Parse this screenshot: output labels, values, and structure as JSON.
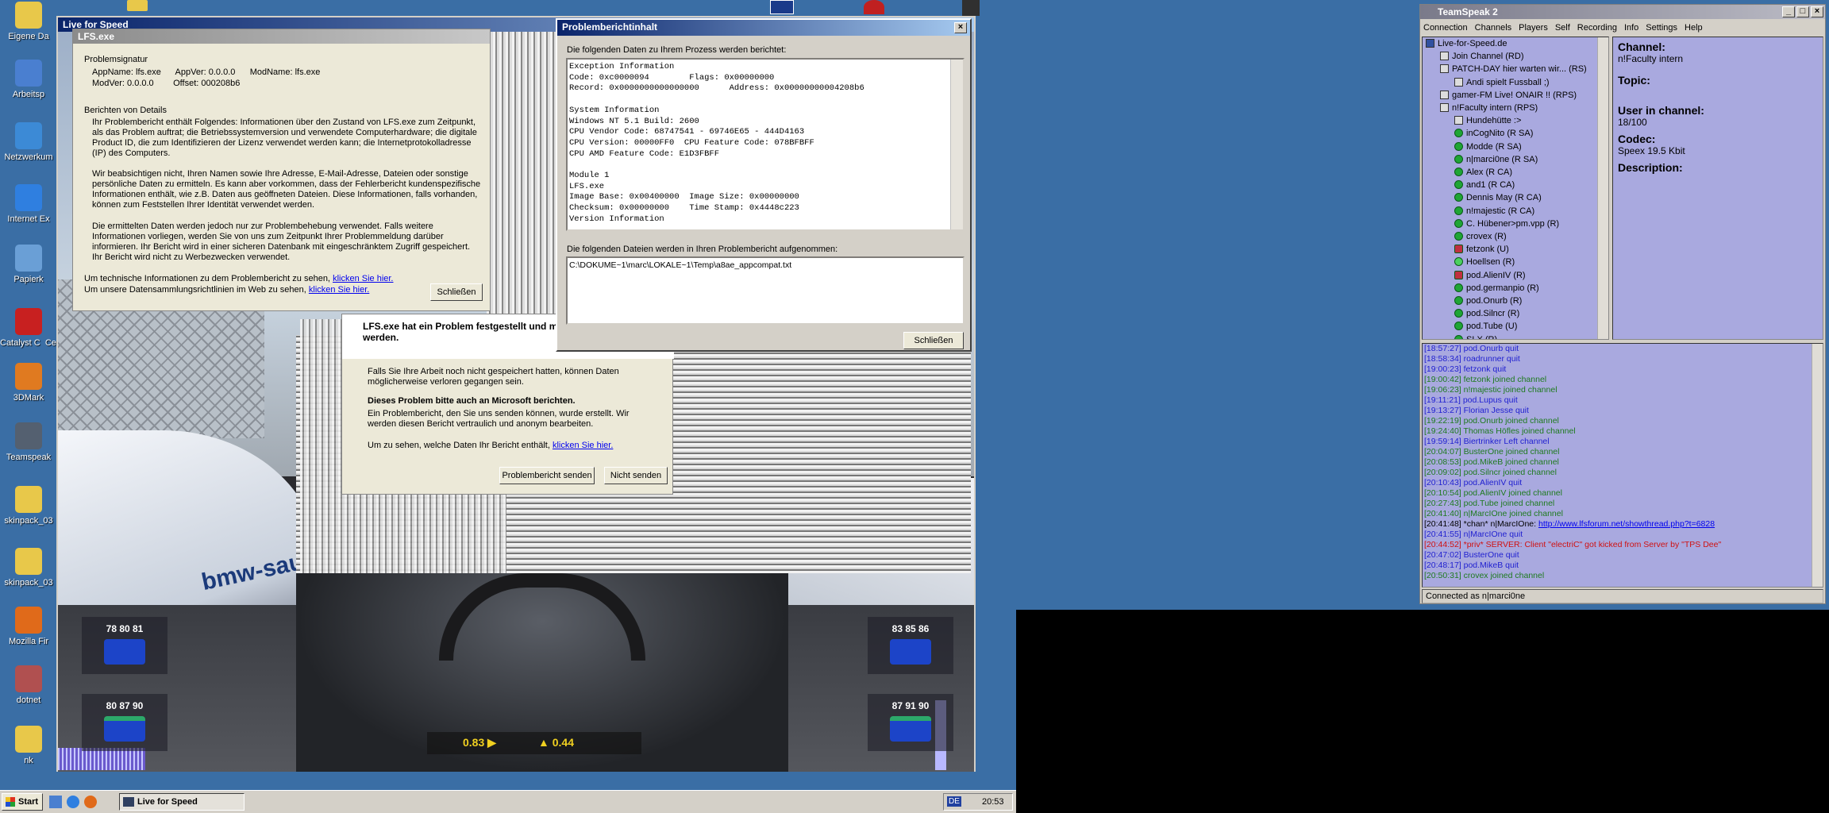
{
  "desktop": {
    "icons": [
      {
        "label": "Eigene Da",
        "color": "#e8c84a"
      },
      {
        "label": "Arbeitsp",
        "color": "#4a7fd0"
      },
      {
        "label": "Netzwerkum",
        "color": "#3c8ad6"
      },
      {
        "label": "Internet Ex",
        "color": "#2f7fe0"
      },
      {
        "label": "Papierk",
        "color": "#6a9fd6"
      },
      {
        "label": "Catalyst C  Cente",
        "color": "#c82020"
      },
      {
        "label": "3DMark",
        "color": "#e07a20"
      },
      {
        "label": "Teamspeak",
        "color": "#546070"
      },
      {
        "label": "skinpack_03",
        "color": "#e8c84a"
      },
      {
        "label": "skinpack_03",
        "color": "#e8c84a"
      },
      {
        "label": "Mozilla Fir",
        "color": "#e06a1a"
      },
      {
        "label": "dotnet",
        "color": "#b05050"
      },
      {
        "label": "nk",
        "color": "#e8c84a"
      }
    ]
  },
  "lfs_window": {
    "title": "Live for Speed",
    "hud": {
      "tyre_fl": "78 80 81",
      "tyre_fr": "83 85 86",
      "tyre_rl": "80 87 90",
      "tyre_rr": "87 91 90",
      "readout_left": "0.83 ▶",
      "readout_right": "▲ 0.44",
      "car_livery": "bmw-saub"
    }
  },
  "lfs_dialog": {
    "title": "LFS.exe",
    "signature_heading": "Problemsignatur",
    "signature_line1": "AppName: lfs.exe      AppVer: 0.0.0.0      ModName: lfs.exe",
    "signature_line2": "ModVer: 0.0.0.0        Offset: 000208b6",
    "details_heading": "Berichten von Details",
    "para1": "Ihr Problembericht enthält Folgendes: Informationen über den Zustand von LFS.exe zum Zeitpunkt, als das Problem auftrat; die Betriebssystemversion und verwendete Computerhardware; die digitale Product ID, die zum Identifizieren der Lizenz verwendet werden kann; die Internetprotokolladresse (IP) des Computers.",
    "para2": "Wir beabsichtigen nicht, Ihren Namen sowie Ihre Adresse, E-Mail-Adresse, Dateien oder sonstige persönliche Daten zu ermitteln. Es kann aber vorkommen, dass der Fehlerbericht kundenspezifische Informationen enthält, wie z.B. Daten aus geöffneten Dateien. Diese Informationen, falls vorhanden, können zum Feststellen Ihrer Identität verwendet werden.",
    "para3": "Die ermittelten Daten werden jedoch nur zur Problembehebung verwendet. Falls weitere Informationen vorliegen, werden Sie von uns zum Zeitpunkt Ihrer Problemmeldung darüber informieren. Ihr Bericht wird in einer sicheren Datenbank mit eingeschränktem Zugriff gespeichert. Ihr Bericht wird nicht zu Werbezwecken verwendet.",
    "tech_text": "Um technische Informationen zu dem Problembericht zu sehen,",
    "tech_link": "klicken Sie hier.",
    "policy_text": "Um unsere Datensammlungsrichtlinien im Web zu sehen,",
    "policy_link": "klicken Sie hier.",
    "close_label": "Schließen"
  },
  "error_dialog": {
    "heading": "LFS.exe hat ein Problem festgestellt und m",
    "heading2": "werden.",
    "info": "Falls Sie Ihre Arbeit noch nicht gespeichert hatten, können Daten möglicherweise verloren gegangen sein.",
    "report_heading": "Dieses Problem bitte auch an Microsoft berichten.",
    "report_text": "Ein Problembericht, den Sie uns senden können, wurde erstellt. Wir werden diesen Bericht vertraulich und anonym bearbeiten.",
    "see_text": "Um zu sehen, welche Daten Ihr Bericht enthält,",
    "see_link": "klicken Sie hier.",
    "send_label": "Problembericht senden",
    "dont_send_label": "Nicht senden"
  },
  "report_window": {
    "title": "Problemberichtinhalt",
    "intro": "Die folgenden Daten zu Ihrem Prozess werden berichtet:",
    "content": "Exception Information\nCode: 0xc0000094        Flags: 0x00000000\nRecord: 0x0000000000000000      Address: 0x00000000004208b6\n\nSystem Information\nWindows NT 5.1 Build: 2600\nCPU Vendor Code: 68747541 - 69746E65 - 444D4163\nCPU Version: 00000FF0  CPU Feature Code: 078BFBFF\nCPU AMD Feature Code: E1D3FBFF\n\nModule 1\nLFS.exe\nImage Base: 0x00400000  Image Size: 0x00000000\nChecksum: 0x00000000    Time Stamp: 0x4448c223\nVersion Information",
    "files_intro": "Die folgenden Dateien werden in Ihren Problembericht aufgenommen:",
    "file_path": "C:\\DOKUME~1\\marc\\LOKALE~1\\Temp\\a8ae_appcompat.txt",
    "close_label": "Schließen"
  },
  "teamspeak": {
    "title": "TeamSpeak 2",
    "menu": [
      "Connection",
      "Channels",
      "Players",
      "Self",
      "Recording",
      "Info",
      "Settings",
      "Help"
    ],
    "tree": [
      {
        "label": "Live-for-Speed.de",
        "indent": 0,
        "kind": "server"
      },
      {
        "label": "Join Channel   (RD)",
        "indent": 1,
        "kind": "channel"
      },
      {
        "label": "PATCH-DAY hier warten wir...   (RS)",
        "indent": 1,
        "kind": "channel"
      },
      {
        "label": "Andi spielt Fussball ;)",
        "indent": 2,
        "kind": "channel"
      },
      {
        "label": "gamer-FM Live! ONAIR !!   (RPS)",
        "indent": 1,
        "kind": "channel"
      },
      {
        "label": "n!Faculty intern   (RPS)",
        "indent": 1,
        "kind": "channel"
      },
      {
        "label": "Hundehütte :>",
        "indent": 2,
        "kind": "channel"
      },
      {
        "label": "inCogNito  (R SA)",
        "indent": 2,
        "kind": "user"
      },
      {
        "label": "Modde  (R SA)",
        "indent": 2,
        "kind": "user"
      },
      {
        "label": "n|marci0ne  (R SA)",
        "indent": 2,
        "kind": "user"
      },
      {
        "label": "Alex  (R CA)",
        "indent": 2,
        "kind": "user"
      },
      {
        "label": "and1  (R CA)",
        "indent": 2,
        "kind": "user"
      },
      {
        "label": "Dennis May  (R CA)",
        "indent": 2,
        "kind": "user"
      },
      {
        "label": "n!majestic  (R CA)",
        "indent": 2,
        "kind": "user"
      },
      {
        "label": "C. Hübener>pm.vpp  (R)",
        "indent": 2,
        "kind": "user"
      },
      {
        "label": "crovex  (R)",
        "indent": 2,
        "kind": "user"
      },
      {
        "label": "fetzonk  (U)",
        "indent": 2,
        "kind": "muted"
      },
      {
        "label": "Hoellsen  (R)",
        "indent": 2,
        "kind": "user2"
      },
      {
        "label": "pod.AlienIV  (R)",
        "indent": 2,
        "kind": "muted"
      },
      {
        "label": "pod.germanpio  (R)",
        "indent": 2,
        "kind": "user"
      },
      {
        "label": "pod.Onurb  (R)",
        "indent": 2,
        "kind": "user"
      },
      {
        "label": "pod.Silncr  (R)",
        "indent": 2,
        "kind": "user"
      },
      {
        "label": "pod.Tube  (U)",
        "indent": 2,
        "kind": "user"
      },
      {
        "label": "SLX  (R)",
        "indent": 2,
        "kind": "user"
      }
    ],
    "info": {
      "channel_label": "Channel:",
      "channel_value": "n!Faculty intern",
      "topic_label": "Topic:",
      "users_label": "User in channel:",
      "users_value": "18/100",
      "codec_label": "Codec:",
      "codec_value": "Speex 19.5 Kbit",
      "description_label": "Description:"
    },
    "log": [
      {
        "text": "[18:57:27] pod.Onurb quit",
        "color": "#1f1fd0"
      },
      {
        "text": "[18:58:34] roadrunner quit",
        "color": "#1f1fd0"
      },
      {
        "text": "[19:00:23] fetzonk quit",
        "color": "#1f1fd0"
      },
      {
        "text": "[19:00:42] fetzonk joined channel",
        "color": "#1e7a1e"
      },
      {
        "text": "[19:06:23] n!majestic joined channel",
        "color": "#1e7a1e"
      },
      {
        "text": "[19:11:21] pod.Lupus quit",
        "color": "#1f1fd0"
      },
      {
        "text": "[19:13:27] Florian Jesse quit",
        "color": "#1f1fd0"
      },
      {
        "text": "[19:22:19] pod.Onurb joined channel",
        "color": "#1e7a1e"
      },
      {
        "text": "[19:24:40] Thomas Höfles joined channel",
        "color": "#1e7a1e"
      },
      {
        "text": "[19:59:14] Biertrinker Left channel",
        "color": "#1f1fd0"
      },
      {
        "text": "[20:04:07] BusterOne joined channel",
        "color": "#1e7a1e"
      },
      {
        "text": "[20:08:53] pod.MikeB joined channel",
        "color": "#1e7a1e"
      },
      {
        "text": "[20:09:02] pod.Silncr joined channel",
        "color": "#1e7a1e"
      },
      {
        "text": "[20:10:43] pod.AlienIV quit",
        "color": "#1f1fd0"
      },
      {
        "text": "[20:10:54] pod.AlienIV joined channel",
        "color": "#1e7a1e"
      },
      {
        "text": "[20:27:43] pod.Tube joined channel",
        "color": "#1e7a1e"
      },
      {
        "text": "[20:41:40] n|MarcIOne joined channel",
        "color": "#1e7a1e"
      },
      {
        "text": "[20:41:48] *chan* n|MarcIOne: ",
        "color": "#000000",
        "link": "http://www.lfsforum.net/showthread.php?t=6828"
      },
      {
        "text": "[20:41:55] n|MarcIOne quit",
        "color": "#1f1fd0"
      },
      {
        "text": "[20:44:52] *priv* SERVER: Client \"electriC\" got kicked from Server by \"TPS Dee\"",
        "color": "#d01010"
      },
      {
        "text": "[20:47:02] BusterOne quit",
        "color": "#1f1fd0"
      },
      {
        "text": "[20:48:17] pod.MikeB quit",
        "color": "#1f1fd0"
      },
      {
        "text": "[20:50:31] crovex joined channel",
        "color": "#1e7a1e"
      }
    ],
    "status": "Connected as n|marci0ne"
  },
  "taskbar": {
    "start_label": "Start",
    "task_label": "Live for Speed",
    "lang": "DE",
    "clock": "20:53"
  }
}
